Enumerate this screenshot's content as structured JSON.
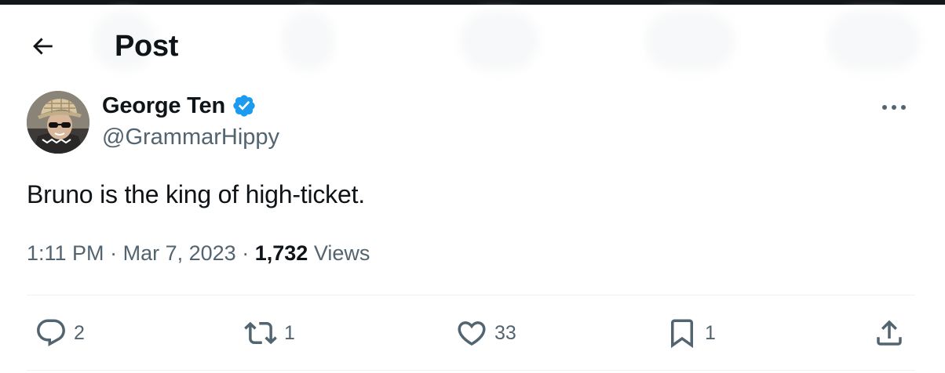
{
  "header": {
    "title": "Post",
    "back_icon": "arrow-left-icon"
  },
  "author": {
    "name": "George Ten",
    "handle": "@GrammarHippy",
    "verified": true,
    "verified_color": "#1d9bf0"
  },
  "post": {
    "text": "Bruno is the king of high-ticket.",
    "time": "1:11 PM",
    "date": "Mar 7, 2023",
    "separator": "·",
    "views_count": "1,732",
    "views_label": "Views"
  },
  "actions": {
    "reply": {
      "icon": "reply-icon",
      "count": "2"
    },
    "repost": {
      "icon": "repost-icon",
      "count": "1"
    },
    "like": {
      "icon": "heart-icon",
      "count": "33"
    },
    "bookmark": {
      "icon": "bookmark-icon",
      "count": "1"
    },
    "share": {
      "icon": "share-icon"
    }
  },
  "colors": {
    "text_primary": "#0f1419",
    "text_secondary": "#536471",
    "divider": "#eff3f4"
  }
}
